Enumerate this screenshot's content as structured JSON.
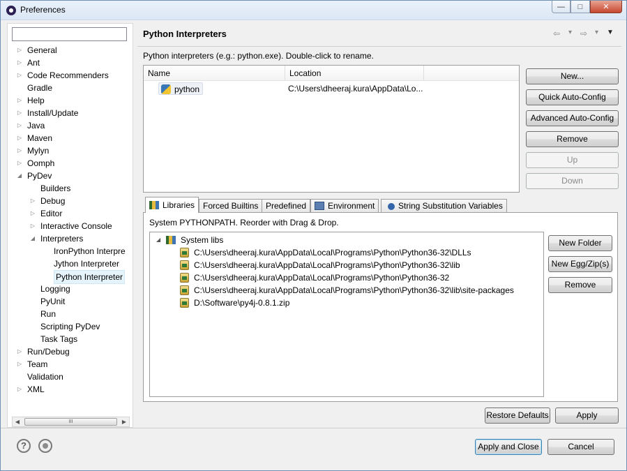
{
  "window": {
    "title": "Preferences",
    "controls": {
      "minimize": "—",
      "maximize": "□",
      "close": "✕"
    }
  },
  "filter": {
    "value": ""
  },
  "tree": {
    "items": [
      {
        "label": "General",
        "twisty": "▷"
      },
      {
        "label": "Ant",
        "twisty": "▷"
      },
      {
        "label": "Code Recommenders",
        "twisty": "▷"
      },
      {
        "label": "Gradle",
        "twisty": ""
      },
      {
        "label": "Help",
        "twisty": "▷"
      },
      {
        "label": "Install/Update",
        "twisty": "▷"
      },
      {
        "label": "Java",
        "twisty": "▷"
      },
      {
        "label": "Maven",
        "twisty": "▷"
      },
      {
        "label": "Mylyn",
        "twisty": "▷"
      },
      {
        "label": "Oomph",
        "twisty": "▷"
      },
      {
        "label": "PyDev",
        "twisty": "◢"
      },
      {
        "label": "Builders",
        "twisty": ""
      },
      {
        "label": "Debug",
        "twisty": "▷"
      },
      {
        "label": "Editor",
        "twisty": "▷"
      },
      {
        "label": "Interactive Console",
        "twisty": "▷"
      },
      {
        "label": "Interpreters",
        "twisty": "◢"
      },
      {
        "label": "IronPython Interpre",
        "twisty": ""
      },
      {
        "label": "Jython Interpreter",
        "twisty": ""
      },
      {
        "label": "Python Interpreter",
        "twisty": ""
      },
      {
        "label": "Logging",
        "twisty": ""
      },
      {
        "label": "PyUnit",
        "twisty": ""
      },
      {
        "label": "Run",
        "twisty": ""
      },
      {
        "label": "Scripting PyDev",
        "twisty": ""
      },
      {
        "label": "Task Tags",
        "twisty": ""
      },
      {
        "label": "Run/Debug",
        "twisty": "▷"
      },
      {
        "label": "Team",
        "twisty": "▷"
      },
      {
        "label": "Validation",
        "twisty": ""
      },
      {
        "label": "XML",
        "twisty": "▷"
      }
    ],
    "scroll": {
      "left": "◀",
      "thumb": "III",
      "right": "▶"
    }
  },
  "page": {
    "title": "Python Interpreters",
    "nav": {
      "back": "⇦",
      "back_menu": "▾",
      "forward": "⇨",
      "forward_menu": "▾",
      "view_menu": "▼"
    },
    "description": "Python interpreters (e.g.: python.exe).   Double-click to rename."
  },
  "interpreters": {
    "columns": [
      "Name",
      "Location"
    ],
    "rows": [
      {
        "name": "python",
        "location": "C:\\Users\\dheeraj.kura\\AppData\\Lo..."
      }
    ]
  },
  "interpreter_buttons": {
    "new": "New...",
    "quick": "Quick Auto-Config",
    "advanced": "Advanced Auto-Config",
    "remove": "Remove",
    "up": "Up",
    "down": "Down"
  },
  "tabs": [
    "Libraries",
    "Forced Builtins",
    "Predefined",
    "Environment",
    "String Substitution Variables"
  ],
  "libraries": {
    "description": "System PYTHONPATH.   Reorder with Drag & Drop.",
    "root": "System libs",
    "root_twisty": "◢",
    "paths": [
      "C:\\Users\\dheeraj.kura\\AppData\\Local\\Programs\\Python\\Python36-32\\DLLs",
      "C:\\Users\\dheeraj.kura\\AppData\\Local\\Programs\\Python\\Python36-32\\lib",
      "C:\\Users\\dheeraj.kura\\AppData\\Local\\Programs\\Python\\Python36-32",
      "C:\\Users\\dheeraj.kura\\AppData\\Local\\Programs\\Python\\Python36-32\\lib\\site-packages",
      "D:\\Software\\py4j-0.8.1.zip"
    ]
  },
  "library_buttons": {
    "new_folder": "New Folder",
    "new_egg": "New Egg/Zip(s)",
    "remove": "Remove"
  },
  "footer": {
    "restore": "Restore Defaults",
    "apply": "Apply",
    "apply_close": "Apply and Close",
    "cancel": "Cancel",
    "help_glyph": "?"
  }
}
